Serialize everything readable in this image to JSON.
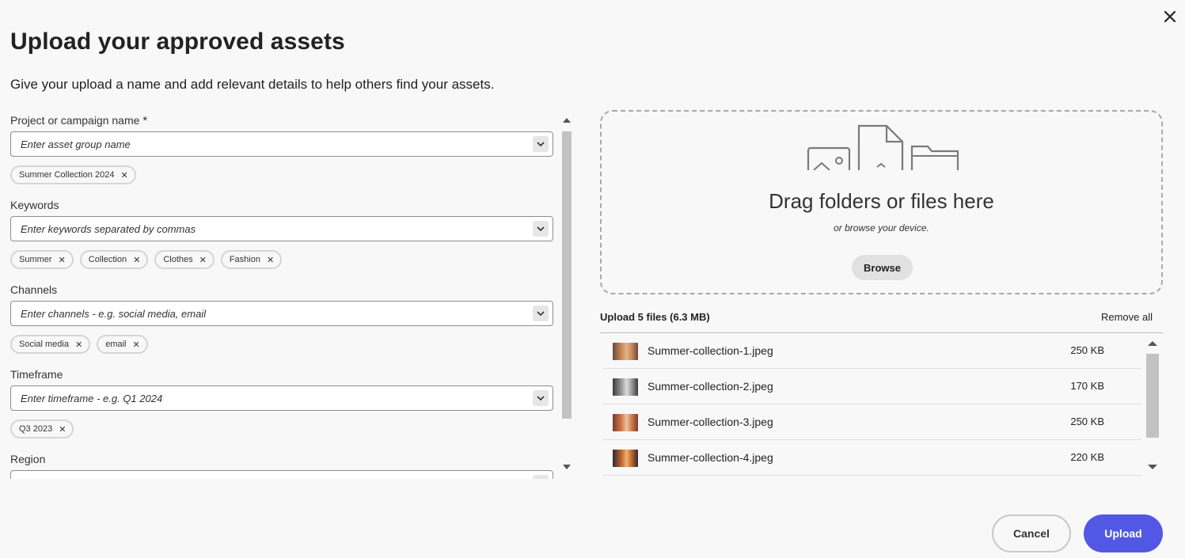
{
  "dialog": {
    "title": "Upload your approved assets",
    "subtitle": "Give your upload a name and add relevant details to help others find your assets.",
    "close_icon": "close-icon"
  },
  "form": {
    "project": {
      "label": "Project or campaign name",
      "required_marker": "*",
      "placeholder": "Enter asset group name",
      "tags": [
        "Summer Collection 2024"
      ]
    },
    "keywords": {
      "label": "Keywords",
      "placeholder": "Enter keywords separated by commas",
      "tags": [
        "Summer",
        "Collection",
        "Clothes",
        "Fashion"
      ]
    },
    "channels": {
      "label": "Channels",
      "placeholder": "Enter channels - e.g. social media, email",
      "tags": [
        "Social media",
        "email"
      ]
    },
    "timeframe": {
      "label": "Timeframe",
      "placeholder": "Enter timeframe - e.g. Q1 2024",
      "tags": [
        "Q3 2023"
      ]
    },
    "region": {
      "label": "Region",
      "placeholder": ""
    },
    "tag_remove_glyph": "✕"
  },
  "dropzone": {
    "title": "Drag folders or files here",
    "subtitle": "or browse your device.",
    "browse_label": "Browse",
    "illustration_icons": [
      "image-file-icon",
      "document-icon",
      "folder-icon"
    ]
  },
  "uploads": {
    "summary": "Upload 5 files (6.3 MB)",
    "remove_all_label": "Remove all",
    "files": [
      {
        "name": "Summer-collection-1.jpeg",
        "size": "250 KB",
        "thumb_colors": [
          "#6b4a3a",
          "#c98a5a",
          "#e0b48a"
        ]
      },
      {
        "name": "Summer-collection-2.jpeg",
        "size": "170 KB",
        "thumb_colors": [
          "#3a3a3a",
          "#9a9a9a",
          "#dcdcdc"
        ]
      },
      {
        "name": "Summer-collection-3.jpeg",
        "size": "250 KB",
        "thumb_colors": [
          "#7a3b2a",
          "#d27a4a",
          "#e8c6a0"
        ]
      },
      {
        "name": "Summer-collection-4.jpeg",
        "size": "220 KB",
        "thumb_colors": [
          "#2b2b3b",
          "#c2662a",
          "#f0b070"
        ]
      }
    ]
  },
  "footer": {
    "cancel_label": "Cancel",
    "upload_label": "Upload"
  },
  "colors": {
    "primary_button": "#5258e4",
    "background": "#f8f8f8",
    "scrollbar_thumb": "#c2c2c2"
  }
}
